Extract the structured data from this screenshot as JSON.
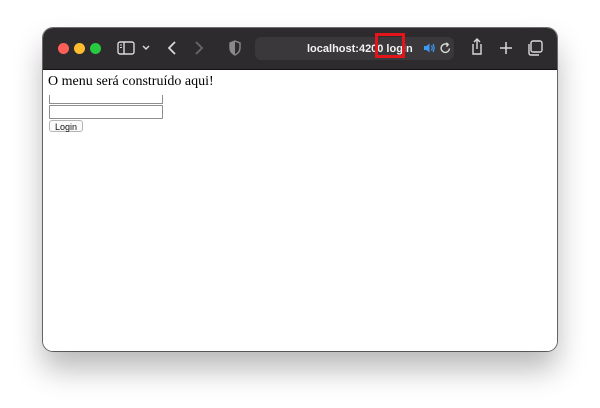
{
  "browser": {
    "address": {
      "host": "localhost:4200",
      "path": "login"
    },
    "icons": [
      "sidebar-icon",
      "chevron-down-icon",
      "back-icon",
      "forward-icon",
      "shield-icon",
      "speaker-icon",
      "reload-icon",
      "share-icon",
      "plus-icon",
      "tabs-icon"
    ],
    "highlight_color": "#e3151a"
  },
  "page": {
    "heading": "O menu será construído aqui!",
    "login_button": "Login"
  }
}
